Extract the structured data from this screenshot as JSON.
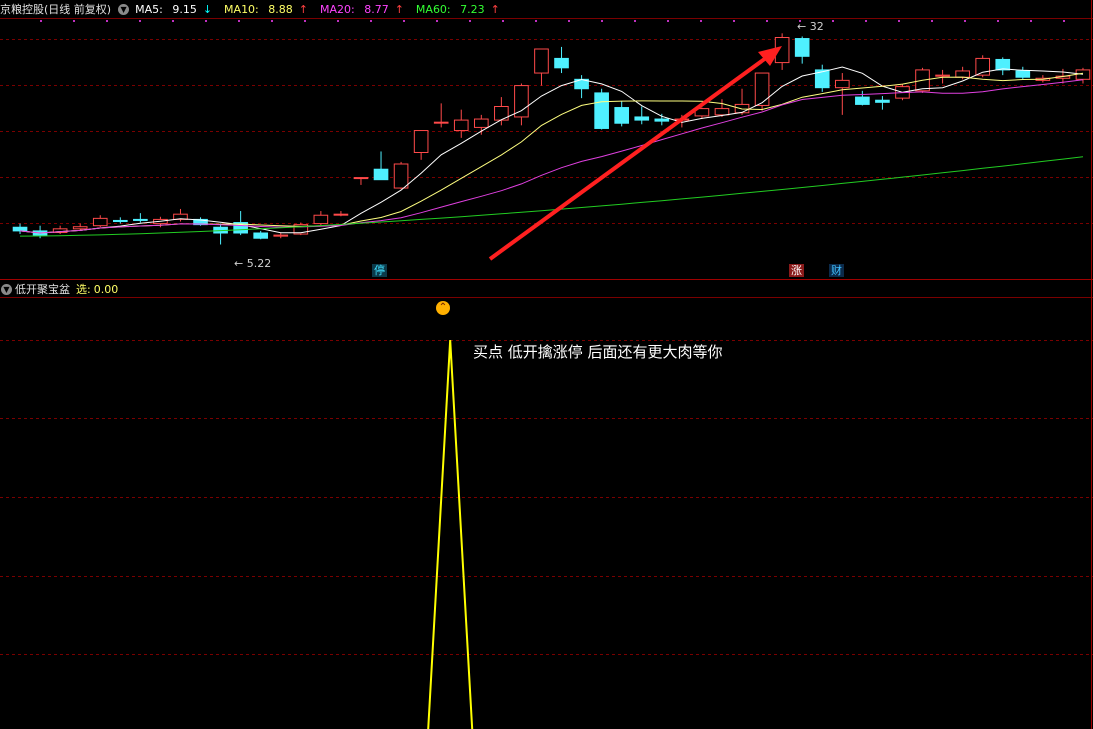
{
  "main_header": {
    "title": "京粮控股(日线 前复权)",
    "collapse_icon": "chevron-down-icon",
    "ma5": {
      "label": "MA5:",
      "value": "9.15",
      "arrow": "↓",
      "color": "#ffffff",
      "arrow_color": "#00ffff"
    },
    "ma10": {
      "label": "MA10:",
      "value": "8.88",
      "arrow": "↑",
      "color": "#ffff66",
      "arrow_color": "#ff4040"
    },
    "ma20": {
      "label": "MA20:",
      "value": "8.77",
      "arrow": "↑",
      "color": "#ff44ff",
      "arrow_color": "#ff4040"
    },
    "ma60": {
      "label": "MA60:",
      "value": "7.23",
      "arrow": "↑",
      "color": "#33ff33",
      "arrow_color": "#ff4040"
    }
  },
  "price_labels": {
    "high": "32",
    "low": "5.22"
  },
  "event_tags": {
    "stop": "停",
    "limit": "涨",
    "finance": "财"
  },
  "indicator_header": {
    "name": "低开聚宝盆",
    "select_label": "选:",
    "select_value": "0.00",
    "collapse_icon": "chevron-down-icon"
  },
  "annotation": "买点 低开擒涨停 后面还有更大肉等你",
  "colors": {
    "up": "#ff4a4a",
    "down": "#4ff0ff",
    "grid": "#7a0000",
    "ma5": "#ffffff",
    "ma10": "#ffff80",
    "ma20": "#e040e0",
    "ma60": "#22cc22",
    "signal": "#ffff00",
    "arrow": "#ff2020"
  },
  "chart_data": {
    "type": "candlestick",
    "price_range": [
      5.0,
      9.4
    ],
    "candles": [
      {
        "o": 5.55,
        "h": 5.62,
        "l": 5.42,
        "c": 5.48
      },
      {
        "o": 5.48,
        "h": 5.58,
        "l": 5.34,
        "c": 5.4
      },
      {
        "o": 5.45,
        "h": 5.58,
        "l": 5.42,
        "c": 5.52
      },
      {
        "o": 5.52,
        "h": 5.62,
        "l": 5.48,
        "c": 5.56
      },
      {
        "o": 5.58,
        "h": 5.78,
        "l": 5.55,
        "c": 5.72
      },
      {
        "o": 5.68,
        "h": 5.74,
        "l": 5.62,
        "c": 5.66
      },
      {
        "o": 5.7,
        "h": 5.82,
        "l": 5.64,
        "c": 5.68
      },
      {
        "o": 5.62,
        "h": 5.75,
        "l": 5.55,
        "c": 5.7
      },
      {
        "o": 5.7,
        "h": 5.9,
        "l": 5.66,
        "c": 5.8
      },
      {
        "o": 5.7,
        "h": 5.74,
        "l": 5.58,
        "c": 5.6
      },
      {
        "o": 5.55,
        "h": 5.62,
        "l": 5.22,
        "c": 5.44
      },
      {
        "o": 5.64,
        "h": 5.86,
        "l": 5.4,
        "c": 5.44
      },
      {
        "o": 5.44,
        "h": 5.48,
        "l": 5.32,
        "c": 5.34
      },
      {
        "o": 5.38,
        "h": 5.44,
        "l": 5.34,
        "c": 5.4
      },
      {
        "o": 5.42,
        "h": 5.64,
        "l": 5.4,
        "c": 5.6
      },
      {
        "o": 5.62,
        "h": 5.86,
        "l": 5.58,
        "c": 5.78
      },
      {
        "o": 5.8,
        "h": 5.86,
        "l": 5.76,
        "c": 5.8
      },
      {
        "o": 6.5,
        "h": 6.5,
        "l": 6.36,
        "c": 6.5
      },
      {
        "o": 6.66,
        "h": 7.0,
        "l": 6.46,
        "c": 6.46
      },
      {
        "o": 6.3,
        "h": 6.8,
        "l": 6.28,
        "c": 6.76
      },
      {
        "o": 6.98,
        "h": 7.4,
        "l": 6.84,
        "c": 7.4
      },
      {
        "o": 7.56,
        "h": 7.92,
        "l": 7.46,
        "c": 7.56
      },
      {
        "o": 7.4,
        "h": 7.8,
        "l": 7.26,
        "c": 7.6
      },
      {
        "o": 7.46,
        "h": 7.7,
        "l": 7.32,
        "c": 7.62
      },
      {
        "o": 7.6,
        "h": 8.04,
        "l": 7.5,
        "c": 7.86
      },
      {
        "o": 7.66,
        "h": 8.3,
        "l": 7.5,
        "c": 8.26
      },
      {
        "o": 8.5,
        "h": 8.96,
        "l": 8.26,
        "c": 8.96
      },
      {
        "o": 8.78,
        "h": 9.0,
        "l": 8.5,
        "c": 8.6
      },
      {
        "o": 8.38,
        "h": 8.46,
        "l": 8.02,
        "c": 8.2
      },
      {
        "o": 8.12,
        "h": 8.2,
        "l": 7.42,
        "c": 7.44
      },
      {
        "o": 7.84,
        "h": 7.96,
        "l": 7.48,
        "c": 7.54
      },
      {
        "o": 7.66,
        "h": 7.86,
        "l": 7.52,
        "c": 7.6
      },
      {
        "o": 7.62,
        "h": 7.72,
        "l": 7.5,
        "c": 7.58
      },
      {
        "o": 7.6,
        "h": 7.7,
        "l": 7.46,
        "c": 7.62
      },
      {
        "o": 7.68,
        "h": 7.84,
        "l": 7.62,
        "c": 7.82
      },
      {
        "o": 7.7,
        "h": 8.0,
        "l": 7.66,
        "c": 7.82
      },
      {
        "o": 7.74,
        "h": 8.2,
        "l": 7.7,
        "c": 7.9
      },
      {
        "o": 7.88,
        "h": 8.5,
        "l": 7.78,
        "c": 8.5
      },
      {
        "o": 8.7,
        "h": 9.26,
        "l": 8.56,
        "c": 9.18
      },
      {
        "o": 9.16,
        "h": 9.2,
        "l": 8.68,
        "c": 8.82
      },
      {
        "o": 8.56,
        "h": 8.66,
        "l": 8.14,
        "c": 8.22
      },
      {
        "o": 8.22,
        "h": 8.5,
        "l": 7.7,
        "c": 8.36
      },
      {
        "o": 8.04,
        "h": 8.16,
        "l": 7.88,
        "c": 7.9
      },
      {
        "o": 7.98,
        "h": 8.06,
        "l": 7.8,
        "c": 7.94
      },
      {
        "o": 8.02,
        "h": 8.28,
        "l": 7.98,
        "c": 8.24
      },
      {
        "o": 8.16,
        "h": 8.6,
        "l": 8.12,
        "c": 8.56
      },
      {
        "o": 8.44,
        "h": 8.56,
        "l": 8.3,
        "c": 8.46
      },
      {
        "o": 8.42,
        "h": 8.62,
        "l": 8.38,
        "c": 8.54
      },
      {
        "o": 8.46,
        "h": 8.84,
        "l": 8.42,
        "c": 8.78
      },
      {
        "o": 8.76,
        "h": 8.8,
        "l": 8.46,
        "c": 8.56
      },
      {
        "o": 8.54,
        "h": 8.62,
        "l": 8.38,
        "c": 8.42
      },
      {
        "o": 8.36,
        "h": 8.46,
        "l": 8.32,
        "c": 8.4
      },
      {
        "o": 8.4,
        "h": 8.58,
        "l": 8.3,
        "c": 8.44
      },
      {
        "o": 8.38,
        "h": 8.6,
        "l": 8.3,
        "c": 8.56
      }
    ],
    "signal": {
      "values_low_high": [
        0,
        1
      ],
      "peak_index": 21
    }
  }
}
